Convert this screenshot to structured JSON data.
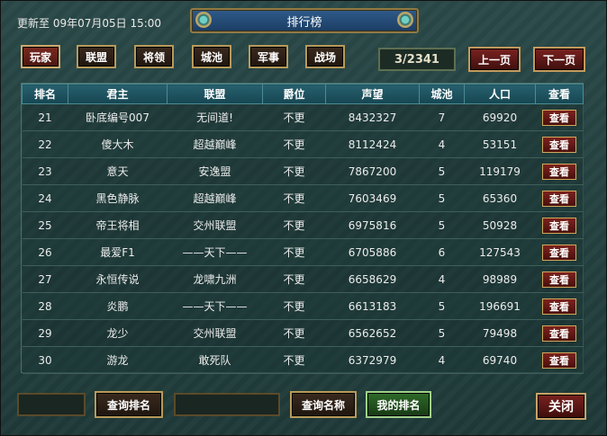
{
  "window": {
    "title": "排行榜"
  },
  "update_text": "更新至 09年07月05日 15:00",
  "tabs": [
    {
      "label": "玩家",
      "active": true
    },
    {
      "label": "联盟",
      "active": false
    },
    {
      "label": "将领",
      "active": false
    },
    {
      "label": "城池",
      "active": false
    },
    {
      "label": "军事",
      "active": false
    },
    {
      "label": "战场",
      "active": false
    }
  ],
  "pager": {
    "page_text": "3/2341",
    "prev_label": "上一页",
    "next_label": "下一页"
  },
  "table": {
    "headers": [
      "排名",
      "君主",
      "联盟",
      "爵位",
      "声望",
      "城池",
      "人口",
      "查看"
    ],
    "rows": [
      {
        "rank": "21",
        "lord": "卧底编号007",
        "alliance": "无间道!",
        "title": "不更",
        "prestige": "8432327",
        "cities": "7",
        "population": "69920",
        "view": "查看"
      },
      {
        "rank": "22",
        "lord": "傻大木",
        "alliance": "超越巅峰",
        "title": "不更",
        "prestige": "8112424",
        "cities": "4",
        "population": "53151",
        "view": "查看"
      },
      {
        "rank": "23",
        "lord": "意天",
        "alliance": "安逸盟",
        "title": "不更",
        "prestige": "7867200",
        "cities": "5",
        "population": "119179",
        "view": "查看"
      },
      {
        "rank": "24",
        "lord": "黑色静脉",
        "alliance": "超越巅峰",
        "title": "不更",
        "prestige": "7603469",
        "cities": "5",
        "population": "65360",
        "view": "查看"
      },
      {
        "rank": "25",
        "lord": "帝王将相",
        "alliance": "交州联盟",
        "title": "不更",
        "prestige": "6975816",
        "cities": "5",
        "population": "50928",
        "view": "查看"
      },
      {
        "rank": "26",
        "lord": "最爱F1",
        "alliance": "——天下——",
        "title": "不更",
        "prestige": "6705886",
        "cities": "6",
        "population": "127543",
        "view": "查看"
      },
      {
        "rank": "27",
        "lord": "永恒传说",
        "alliance": "龙啸九洲",
        "title": "不更",
        "prestige": "6658629",
        "cities": "4",
        "population": "98989",
        "view": "查看"
      },
      {
        "rank": "28",
        "lord": "炎鹏",
        "alliance": "——天下——",
        "title": "不更",
        "prestige": "6613183",
        "cities": "5",
        "population": "196691",
        "view": "查看"
      },
      {
        "rank": "29",
        "lord": "龙少",
        "alliance": "交州联盟",
        "title": "不更",
        "prestige": "6562652",
        "cities": "5",
        "population": "79498",
        "view": "查看"
      },
      {
        "rank": "30",
        "lord": "游龙",
        "alliance": "敢死队",
        "title": "不更",
        "prestige": "6372979",
        "cities": "4",
        "population": "69740",
        "view": "查看"
      }
    ]
  },
  "bottom": {
    "rank_input_value": "",
    "query_rank_label": "查询排名",
    "name_input_value": "",
    "query_name_label": "查询名称",
    "my_rank_label": "我的排名",
    "close_label": "关闭"
  },
  "colors": {
    "accent_gold": "#b89a5a",
    "active_red": "#7a2a22",
    "header_teal": "#27606d",
    "my_rank_green": "#2f6a2a"
  }
}
